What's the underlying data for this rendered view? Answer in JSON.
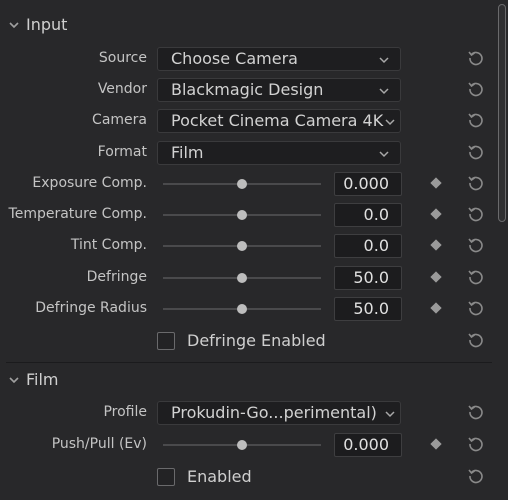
{
  "sections": {
    "input": {
      "title": "Input"
    },
    "film": {
      "title": "Film"
    }
  },
  "input_rows": {
    "source": {
      "label": "Source",
      "value": "Choose Camera"
    },
    "vendor": {
      "label": "Vendor",
      "value": "Blackmagic Design"
    },
    "camera": {
      "label": "Camera",
      "value": "Pocket Cinema Camera 4K"
    },
    "format": {
      "label": "Format",
      "value": "Film"
    },
    "exposure": {
      "label": "Exposure Comp.",
      "value": "0.000",
      "slider_fraction": 0.5
    },
    "temperature": {
      "label": "Temperature Comp.",
      "value": "0.0",
      "slider_fraction": 0.5
    },
    "tint": {
      "label": "Tint Comp.",
      "value": "0.0",
      "slider_fraction": 0.5
    },
    "defringe": {
      "label": "Defringe",
      "value": "50.0",
      "slider_fraction": 0.5
    },
    "defringe_radius": {
      "label": "Defringe Radius",
      "value": "50.0",
      "slider_fraction": 0.5
    },
    "defringe_enabled": {
      "label": "Defringe Enabled",
      "checked": false
    }
  },
  "film_rows": {
    "profile": {
      "label": "Profile",
      "value": "Prokudin-Go...perimental)"
    },
    "push_pull": {
      "label": "Push/Pull (Ev)",
      "value": "0.000",
      "slider_fraction": 0.5
    },
    "enabled": {
      "label": "Enabled",
      "checked": false
    }
  },
  "icons": {
    "section_toggle": "chevron-down-icon",
    "dropdown": "chevron-down-icon",
    "keyframe": "diamond-icon",
    "reset": "reset-icon"
  },
  "colors": {
    "background": "#28282a",
    "field": "#1e1e20",
    "text": "#c9c9c9"
  }
}
